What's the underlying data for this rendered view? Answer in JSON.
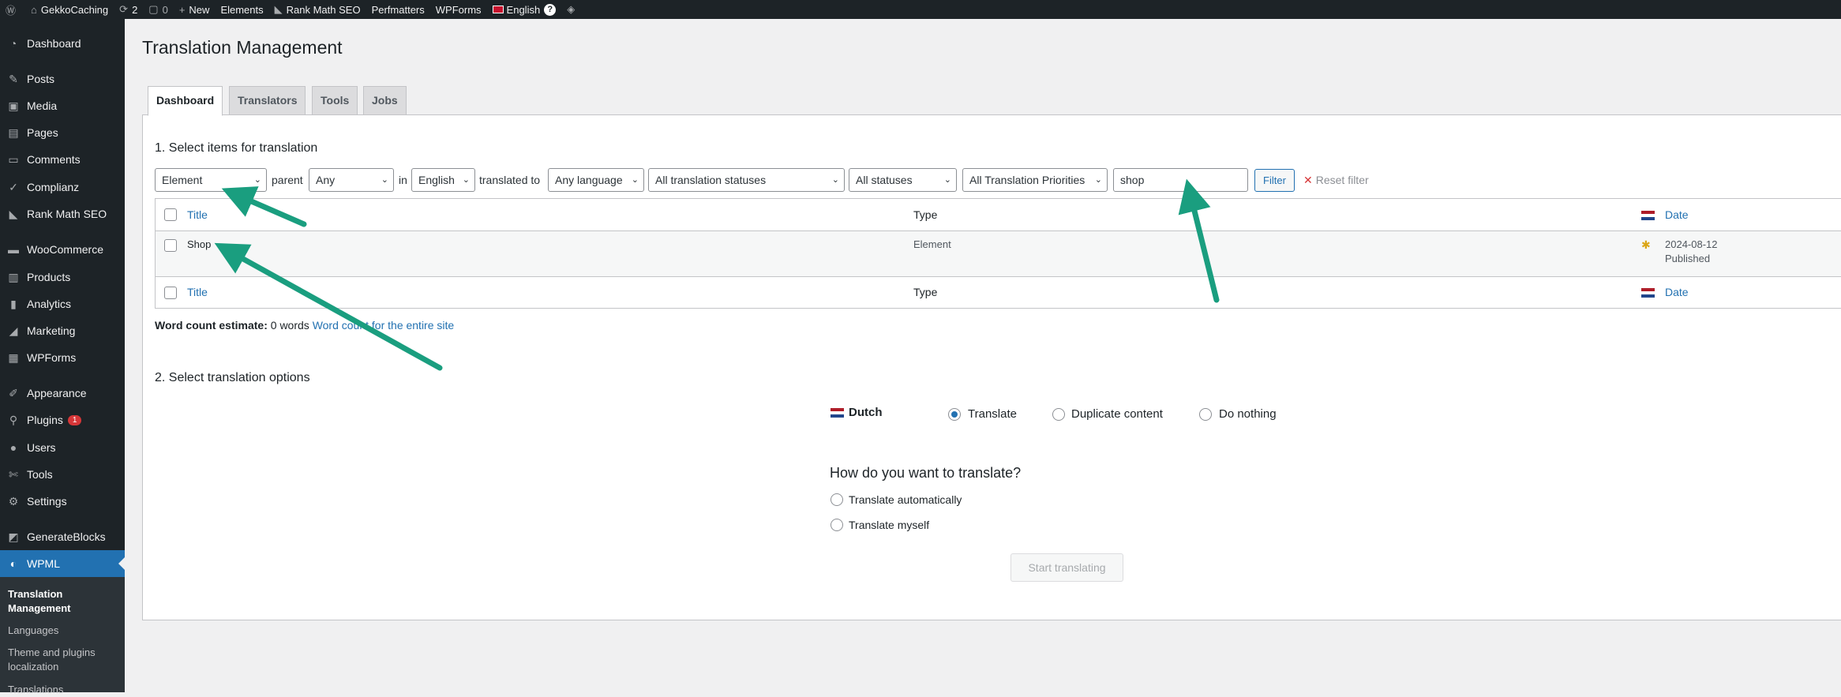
{
  "adminbar": {
    "site": "GekkoCaching",
    "updates": "2",
    "comments": "0",
    "new": "New",
    "elements": "Elements",
    "rankmath": "Rank Math SEO",
    "perfmatters": "Perfmatters",
    "wpforms": "WPForms",
    "language": "English"
  },
  "sidebar": {
    "items": [
      {
        "label": "Dashboard",
        "icon": "dashboard-icon"
      },
      {
        "label": "Posts",
        "icon": "pin-icon"
      },
      {
        "label": "Media",
        "icon": "media-icon"
      },
      {
        "label": "Pages",
        "icon": "pages-icon"
      },
      {
        "label": "Comments",
        "icon": "comments-icon"
      },
      {
        "label": "Complianz",
        "icon": "check-icon"
      },
      {
        "label": "Rank Math SEO",
        "icon": "chart-icon"
      },
      {
        "label": "WooCommerce",
        "icon": "woo-icon"
      },
      {
        "label": "Products",
        "icon": "products-icon"
      },
      {
        "label": "Analytics",
        "icon": "analytics-icon"
      },
      {
        "label": "Marketing",
        "icon": "megaphone-icon"
      },
      {
        "label": "WPForms",
        "icon": "forms-icon"
      },
      {
        "label": "Appearance",
        "icon": "brush-icon"
      },
      {
        "label": "Plugins",
        "icon": "plug-icon",
        "badge": "1"
      },
      {
        "label": "Users",
        "icon": "user-icon"
      },
      {
        "label": "Tools",
        "icon": "wrench-icon"
      },
      {
        "label": "Settings",
        "icon": "settings-icon"
      },
      {
        "label": "GenerateBlocks",
        "icon": "blocks-icon"
      },
      {
        "label": "WPML",
        "icon": "wpml-icon"
      }
    ],
    "submenu": [
      "Translation Management",
      "Languages",
      "Theme and plugins localization",
      "Translations"
    ]
  },
  "page": {
    "title": "Translation Management",
    "tabs": [
      "Dashboard",
      "Translators",
      "Tools",
      "Jobs"
    ]
  },
  "section1": {
    "heading": "1. Select items for translation",
    "filters": {
      "type": "Element",
      "parent_label": "parent",
      "parent": "Any",
      "in_label": "in",
      "language": "English",
      "translated_to_label": "translated to",
      "target": "Any language",
      "translation_status": "All translation statuses",
      "status": "All statuses",
      "priority": "All Translation Priorities",
      "search": "shop",
      "filter_button": "Filter",
      "reset": "Reset filter"
    },
    "table": {
      "col_title": "Title",
      "col_type": "Type",
      "col_date": "Date",
      "row": {
        "title": "Shop",
        "type": "Element",
        "date": "2024-08-12",
        "status": "Published"
      }
    },
    "word_count_label": "Word count estimate:",
    "word_count_value": "0 words",
    "word_count_link": "Word count for the entire site"
  },
  "section2": {
    "heading": "2. Select translation options",
    "language": "Dutch",
    "options": [
      "Translate",
      "Duplicate content",
      "Do nothing"
    ],
    "question": "How do you want to translate?",
    "methods": [
      "Translate automatically",
      "Translate myself"
    ],
    "start_button": "Start translating"
  },
  "colors": {
    "accent": "#2271b1",
    "adminbar": "#1d2327",
    "arrow": "#1a9e7f"
  }
}
